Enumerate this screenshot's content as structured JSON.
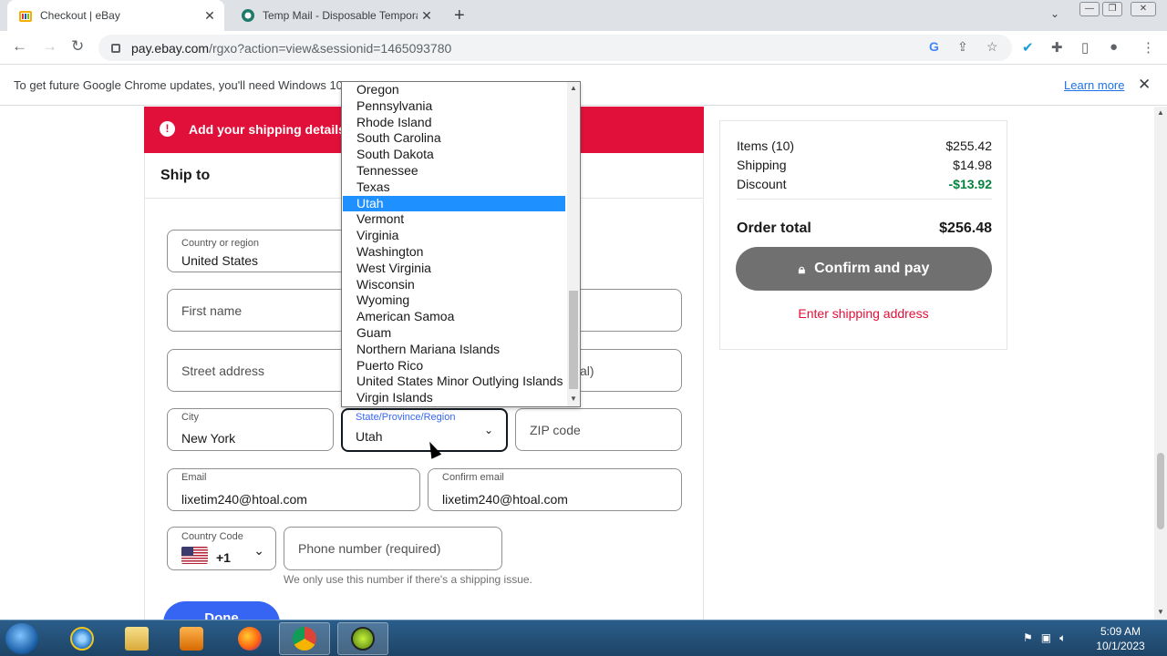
{
  "browser": {
    "tabs": [
      {
        "title": "Checkout | eBay",
        "active": true
      },
      {
        "title": "Temp Mail - Disposable Tempora",
        "active": false
      }
    ],
    "url_host": "pay.ebay.com",
    "url_path": "/rgxo?action=view&sessionid=1465093780",
    "infobar": {
      "message": "To get future Google Chrome updates, you'll need Windows 10",
      "link": "Learn more"
    }
  },
  "alert": {
    "text": "Add your shipping details a"
  },
  "form": {
    "title": "Ship to",
    "country": {
      "label": "Country or region",
      "value": "United States"
    },
    "first_name": {
      "placeholder": "First name"
    },
    "street": {
      "placeholder": "Street address"
    },
    "street2_suffix": "al)",
    "city": {
      "label": "City",
      "value": "New York"
    },
    "state": {
      "label": "State/Province/Region",
      "value": "Utah"
    },
    "zip": {
      "placeholder": "ZIP code"
    },
    "email": {
      "label": "Email",
      "value": "lixetim240@htoal.com"
    },
    "confirm_email": {
      "label": "Confirm email",
      "value": "lixetim240@htoal.com"
    },
    "country_code": {
      "label": "Country Code",
      "value": "+1"
    },
    "phone": {
      "placeholder": "Phone number (required)"
    },
    "phone_hint": "We only use this number if there's a shipping issue.",
    "done_label": "Done"
  },
  "dropdown": {
    "options": [
      "Oregon",
      "Pennsylvania",
      "Rhode Island",
      "South Carolina",
      "South Dakota",
      "Tennessee",
      "Texas",
      "Utah",
      "Vermont",
      "Virginia",
      "Washington",
      "West Virginia",
      "Wisconsin",
      "Wyoming",
      "American Samoa",
      "Guam",
      "Northern Mariana Islands",
      "Puerto Rico",
      "United States Minor Outlying Islands",
      "Virgin Islands"
    ],
    "selected": "Utah"
  },
  "summary": {
    "items_label": "Items (10)",
    "items_value": "$255.42",
    "shipping_label": "Shipping",
    "shipping_value": "$14.98",
    "discount_label": "Discount",
    "discount_value": "-$13.92",
    "total_label": "Order total",
    "total_value": "$256.48",
    "confirm_label": "Confirm and pay",
    "warning": "Enter shipping address"
  },
  "taskbar": {
    "time": "5:09 AM",
    "date": "10/1/2023"
  },
  "colors": {
    "ebay_red": "#e0103a",
    "ebay_blue": "#3665f3",
    "discount_green": "#05823f",
    "selected_option": "#1e90ff"
  }
}
